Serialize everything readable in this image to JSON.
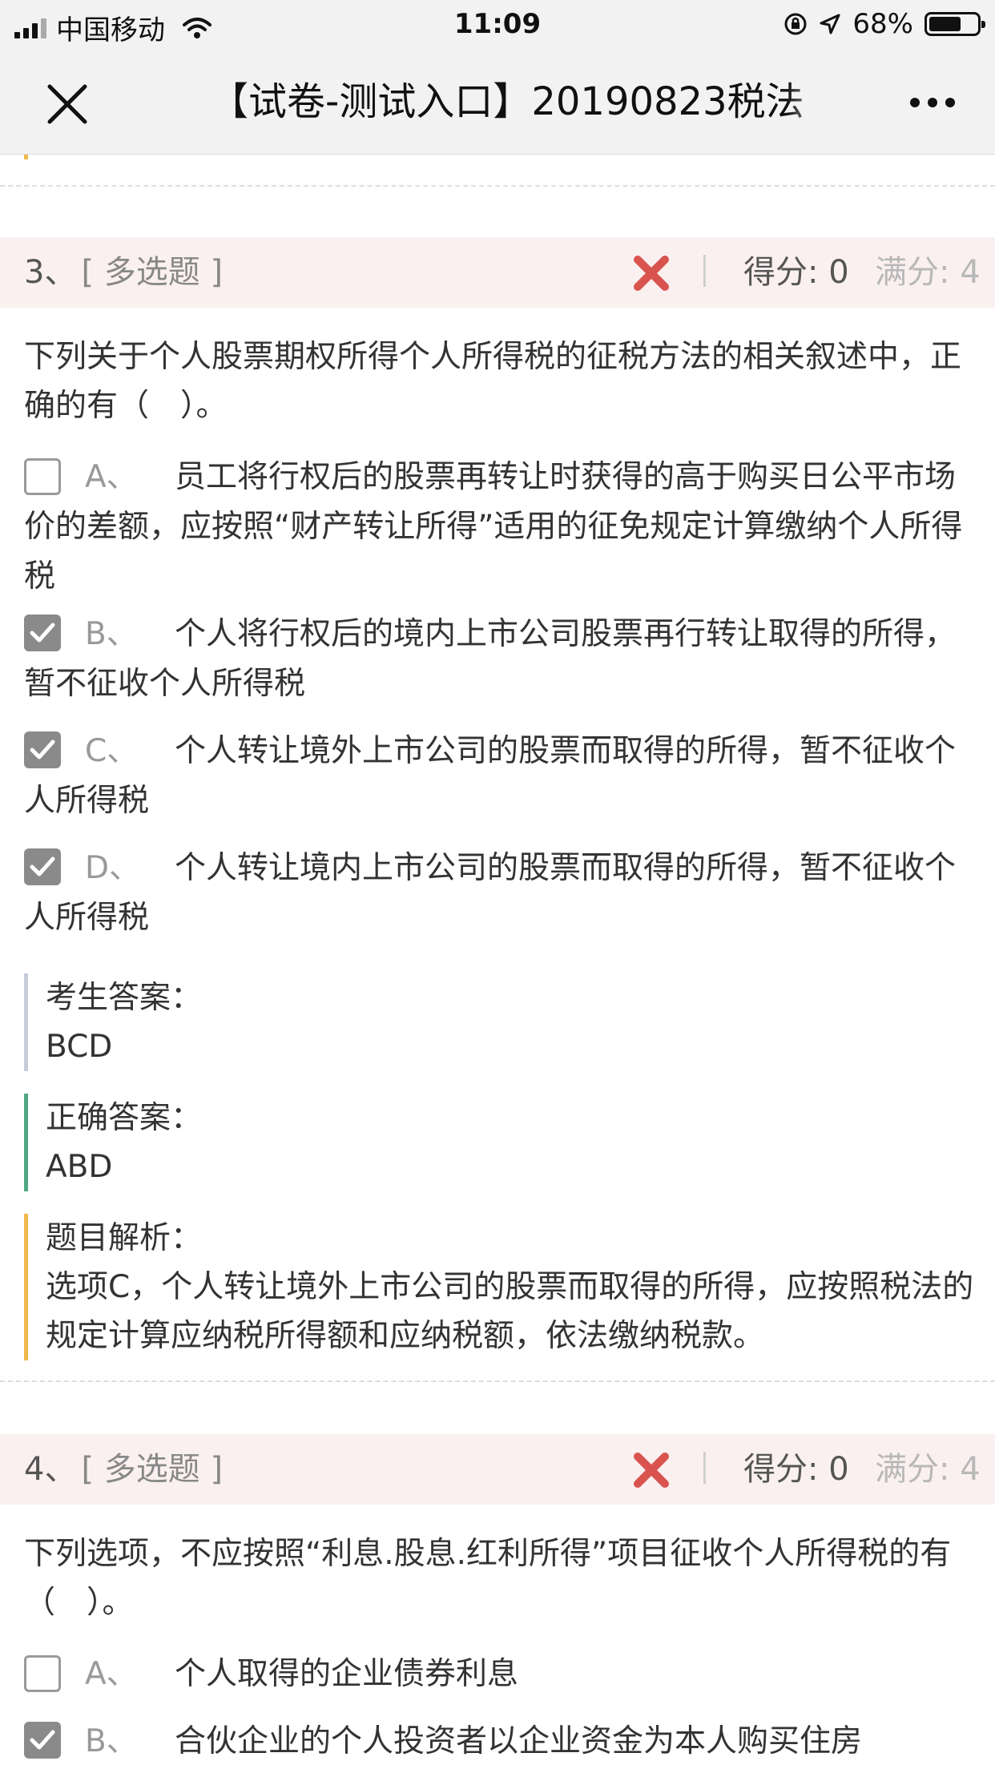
{
  "status_bar": {
    "carrier": "中国移动",
    "time": "11:09",
    "battery": "68%",
    "battery_level": 0.68
  },
  "nav": {
    "title": "【试卷-测试入口】20190823税法"
  },
  "questions": [
    {
      "number": "3、",
      "type": "[ 多选题 ]",
      "score": "得分: 0",
      "full": "满分: 4",
      "stem": "下列关于个人股票期权所得个人所得税的征税方法的相关叙述中，正确的有（　）。",
      "options": [
        {
          "letter": "A、",
          "text": "员工将行权后的股票再转让时获得的高于购买日公平市场价的差额，应按照“财产转让所得”适用的征免规定计算缴纳个人所得税",
          "checked": false
        },
        {
          "letter": "B、",
          "text": "个人将行权后的境内上市公司股票再行转让取得的所得，暂不征收个人所得税",
          "checked": true
        },
        {
          "letter": "C、",
          "text": "个人转让境外上市公司的股票而取得的所得，暂不征收个人所得税",
          "checked": true
        },
        {
          "letter": "D、",
          "text": "个人转让境内上市公司的股票而取得的所得，暂不征收个人所得税",
          "checked": true
        }
      ],
      "user_answer_label": "考生答案：",
      "user_answer": "BCD",
      "correct_answer_label": "正确答案：",
      "correct_answer": "ABD",
      "explain_label": "题目解析：",
      "explain": "选项C，个人转让境外上市公司的股票而取得的所得，应按照税法的规定计算应纳税所得额和应纳税额，依法缴纳税款。"
    },
    {
      "number": "4、",
      "type": "[ 多选题 ]",
      "score": "得分: 0",
      "full": "满分: 4",
      "stem": "下列选项，不应按照“利息.股息.红利所得”项目征收个人所得税的有（　）。",
      "options": [
        {
          "letter": "A、",
          "text": "个人取得的企业债券利息",
          "checked": false
        },
        {
          "letter": "B、",
          "text": "合伙企业的个人投资者以企业资金为本人购买住房",
          "checked": true
        }
      ]
    }
  ],
  "colors": {
    "header_bg": "#fbf0f0",
    "wrong_mark": "#d9534f",
    "correct_bar": "#4fa880",
    "explain_bar": "#f0b84a",
    "user_bar": "#c5ced8"
  }
}
